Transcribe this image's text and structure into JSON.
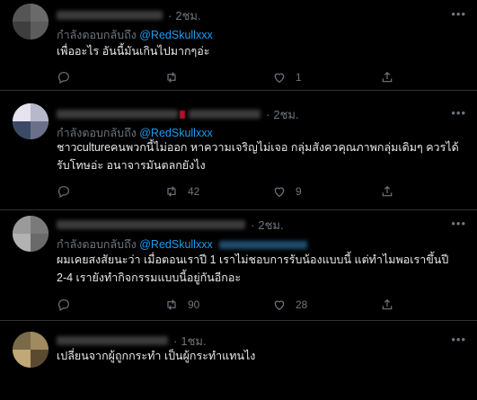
{
  "reply_prefix": "กำลังตอบกลับถึง",
  "tweets": [
    {
      "time": "2ชม.",
      "reply_handle": "@RedSkullxxx",
      "text": "เพื่ออะไร อันนี้มันเกินไปมากๆอ่ะ",
      "replies": "",
      "retweets": "",
      "likes": "1",
      "avatar_colors": [
        "#4a4a4a",
        "#5b5b5b",
        "#6a6a6a",
        "#3d3d3d"
      ]
    },
    {
      "time": "2ชม.",
      "reply_handle": "@RedSkullxxx",
      "text": "ชาวcultureคนพวกนี้ไม่ออก หาความเจริญไม่เจอ กลุ่มสังควคุณภาพกลุ่มเดิมๆ ควรได้รับโทษอ่ะ อนาจารมันตลกยังไง",
      "replies": "",
      "retweets": "42",
      "likes": "9",
      "avatar_colors": [
        "#e7e3ee",
        "#3a4a66",
        "#6b6f8a",
        "#b8b8c8"
      ]
    },
    {
      "time": "2ชม.",
      "reply_handle": "@RedSkullxxx",
      "text": "ผมเคยสงสัยนะว่า เมื่อตอนเราปี 1 เราไม่ชอบการรับน้องแบบนี้ แต่ทำไมพอเราขึ้นปี 2-4 เรายังทำกิจกรรมแบบนี้อยู่กันอีกอะ",
      "replies": "",
      "retweets": "90",
      "likes": "28",
      "avatar_colors": [
        "#8a8a8a",
        "#b0b0b0",
        "#6e6e6e",
        "#9d9d9d"
      ]
    },
    {
      "time": "1ชม.",
      "text": "เปลี่ยนจากผู้ถูกกระทำ เป็นผู้กระทำแทนไง",
      "avatar_colors": [
        "#7a6a4a",
        "#a08a60",
        "#5a4a30",
        "#c0a878"
      ]
    }
  ],
  "icons": {
    "reply": "reply-icon",
    "retweet": "retweet-icon",
    "like": "like-icon",
    "more": "more-icon"
  },
  "colors": {
    "background": "#000000",
    "link": "#1d9bf0",
    "muted": "#6e767d",
    "text": "#e7e9ea",
    "divider": "#2f3336"
  }
}
